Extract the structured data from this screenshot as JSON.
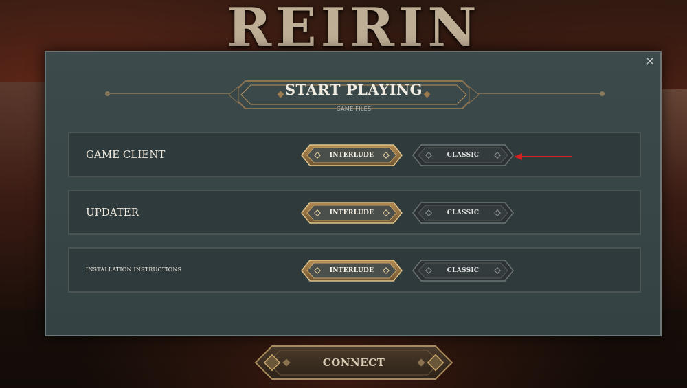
{
  "logo_text": "REIRIN",
  "dialog": {
    "title": "START PLAYING",
    "subtitle": "GAME FILES",
    "close_icon": "×"
  },
  "rows": [
    {
      "label": "GAME CLIENT",
      "gold_button": "INTERLUDE",
      "dark_button": "CLASSIC"
    },
    {
      "label": "UPDATER",
      "gold_button": "INTERLUDE",
      "dark_button": "CLASSIC"
    },
    {
      "label": "INSTALLATION INSTRUCTIONS",
      "gold_button": "INTERLUDE",
      "dark_button": "CLASSIC"
    }
  ],
  "connect_label": "CONNECT",
  "colors": {
    "accent_gold": "#c9a66b",
    "dialog_bg": "#3a4749",
    "arrow": "#d62020"
  }
}
